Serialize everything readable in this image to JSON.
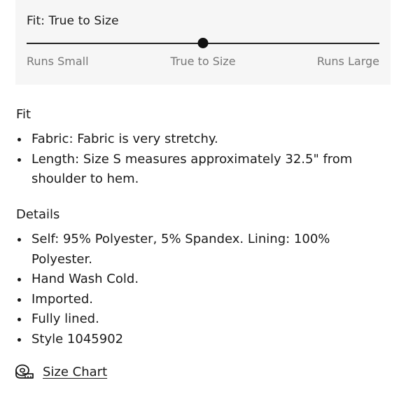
{
  "fit_meter": {
    "title": "Fit: True to Size",
    "position": 0.5,
    "labels": [
      "Runs Small",
      "True to Size",
      "Runs Large"
    ]
  },
  "fit_section": {
    "title": "Fit",
    "items": [
      "Fabric: Fabric is very stretchy.",
      "Length: Size S measures approximately 32.5\" from shoulder to hem."
    ]
  },
  "details_section": {
    "title": "Details",
    "items": [
      "Self: 95% Polyester, 5% Spandex. Lining: 100% Polyester.",
      "Hand Wash Cold.",
      "Imported.",
      "Fully lined.",
      "Style 1045902"
    ]
  },
  "size_chart": {
    "label": "Size Chart",
    "icon": "measuring-tape-icon"
  }
}
